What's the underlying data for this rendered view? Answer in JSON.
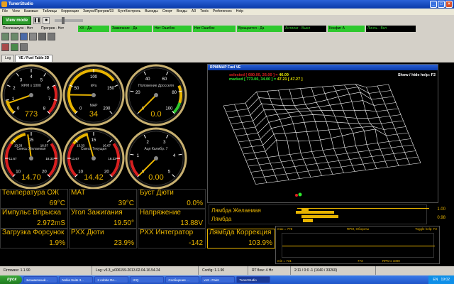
{
  "window": {
    "title": "TunerStudio"
  },
  "menu": [
    "File",
    "View",
    "Базовые",
    "Таблицы",
    "Коррекции",
    "Запуск/Прогрев/33",
    "БустКонтроль",
    "Выходы",
    "Спорт",
    "Входы",
    "АЗ",
    "Tools",
    "Preferences",
    "Help"
  ],
  "toolbar": {
    "view_mode_label": "View mode"
  },
  "indicators": [
    {
      "label": "Послезапуск - Нет",
      "bg": "#d4d0c8"
    },
    {
      "label": "Прогрев - Нет",
      "bg": "#d4d0c8"
    },
    {
      "label": "ХХ - Да",
      "bg": "#2ec82e"
    },
    {
      "label": "Зажигание - Да",
      "bg": "#2ec82e"
    },
    {
      "label": "Нет Ошибок",
      "bg": "#2ec82e"
    },
    {
      "label": "Нет Ошибок",
      "bg": "#2ec82e"
    },
    {
      "label": "Вращается - Да",
      "bg": "#2ec82e"
    },
    {
      "label": "Антилаг - Выкл",
      "bg": "#000000"
    },
    {
      "label": "Конфиг A",
      "bg": "#2ec82e"
    },
    {
      "label": "Линчь - Вкл",
      "bg": "#000000"
    }
  ],
  "tabs": [
    {
      "label": "Log"
    },
    {
      "label": "VE / Fuel Table 3D"
    }
  ],
  "gauges": [
    {
      "title": "RPM x 1000",
      "value": "773",
      "min": 0,
      "max": 8,
      "level": 0.77,
      "ticks": [
        "0",
        "1",
        "2",
        "3",
        "4",
        "5",
        "6",
        "7",
        "8"
      ]
    },
    {
      "title": "kPa",
      "sub": "MAP",
      "value": "34",
      "min": 0,
      "max": 200,
      "level": 34,
      "ticks": [
        "0",
        "50",
        "100",
        "150",
        "200"
      ]
    },
    {
      "title": "Положение Дросселя",
      "value": "0.0",
      "min": 0,
      "max": 100,
      "level": 0,
      "ticks": [
        "0",
        "20",
        "40",
        "60",
        "80",
        "100"
      ]
    },
    {
      "title": "Смесь Желаемая",
      "value": "14.70",
      "min": 10,
      "max": 20,
      "level": 14.7,
      "ticks": [
        "10",
        "11.67",
        "13.33",
        "15",
        "16.67",
        "18.33",
        "20"
      ]
    },
    {
      "title": "Смесь Текущая",
      "value": "14.42",
      "min": 10,
      "max": 20,
      "level": 14.42,
      "ticks": [
        "10",
        "11.67",
        "13.33",
        "15",
        "16.67",
        "18.33",
        "20"
      ]
    },
    {
      "title": "Ацп Калибр. 7",
      "value": "0.00",
      "min": 0,
      "max": 5,
      "level": 0,
      "ticks": [
        "0",
        "1",
        "2",
        "3",
        "4",
        "5"
      ]
    }
  ],
  "table3d": {
    "title": "RPM/MAP Fuel VE",
    "selected_label": "selected",
    "selected": "[ 680.00,  26.00 ] =",
    "selected_val": "46.09",
    "marked_label": "marked",
    "marked": "[ 773.00,  34.00 ] =",
    "marked_val": "47.21",
    "marked_extra": "[ 47.27 ]",
    "help": "Show / hide help: F2"
  },
  "readouts": [
    {
      "label": "Температура ОЖ",
      "value": "69°C"
    },
    {
      "label": "МАТ",
      "value": "39°C"
    },
    {
      "label": "Буст Дюти",
      "value": "0.0%"
    },
    {
      "label": "Импульс Впрыска",
      "value": "2.972mS"
    },
    {
      "label": "Угол Зажигания",
      "value": "19.50°"
    },
    {
      "label": "Напряжение",
      "value": "13.88V"
    },
    {
      "label": "Загрузка Форсунок",
      "value": "1.9%"
    },
    {
      "label": "РХХ Дюти",
      "value": "23.9%"
    },
    {
      "label": "РХХ Интегратор",
      "value": "-142"
    },
    {
      "label": "Лямбда Коррекция",
      "value": "103.9%"
    }
  ],
  "lambda_bars": [
    {
      "label": "Лямбда Желаемая",
      "value": "1.00"
    },
    {
      "label": "Лямбда",
      "value": "0.98"
    }
  ],
  "graph": {
    "max_label": "max = 778",
    "title": "RPM, Обороты",
    "help": "Toggle help: F2",
    "min_label": "min = 731",
    "current": "773",
    "scale": "RPM x 1000"
  },
  "statusbar": [
    "Firmware: 1.1.90",
    "Log: v3.3_u006159-2013.02.04-16.54.24",
    "Config: 1.1.90",
    "RT flow: 4 Hz",
    "2:11 / 0:0 -1 (1640 / 33260)"
  ],
  "taskbar": {
    "start": "пуск",
    "tasks": [
      "Безымянный...",
      "Nokia Suite 3...",
      "2 Adobe Re...",
      "ICQ",
      "Сообщение ...",
      "vs3 - Paint",
      "TunerStudio"
    ],
    "lang": "EN",
    "time": "19:02"
  },
  "colors": {
    "accent": "#e8b400",
    "green": "#2ec82e",
    "red": "#d82020"
  }
}
